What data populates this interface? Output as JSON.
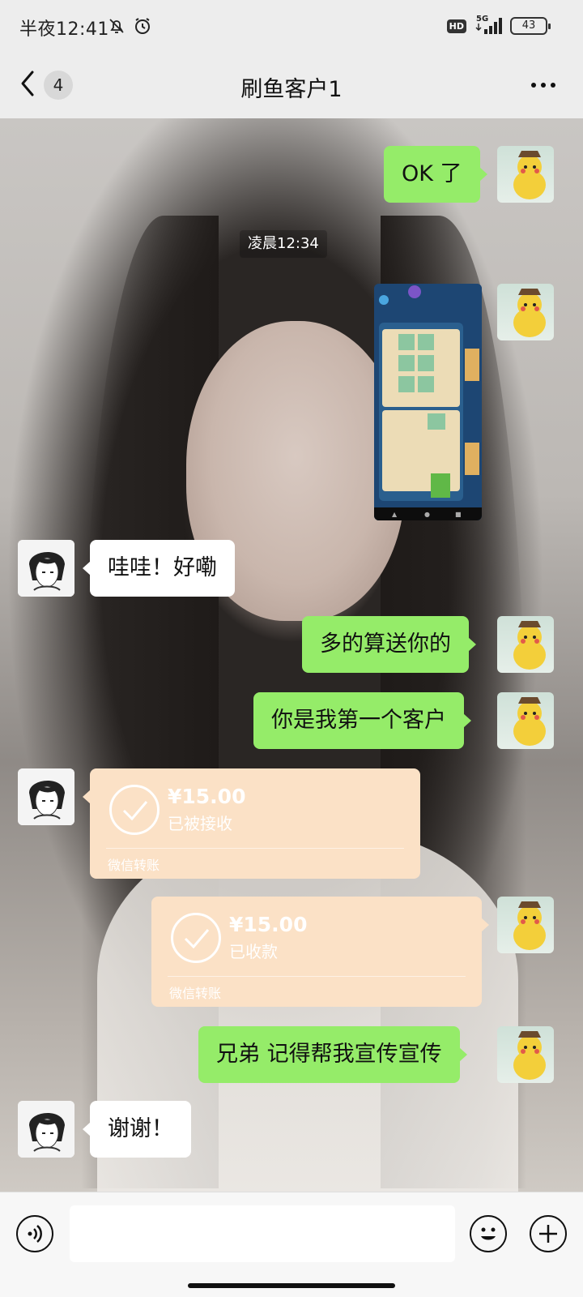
{
  "status_bar": {
    "time": "半夜12:41",
    "hd": "HD",
    "network": "5G",
    "battery": "43"
  },
  "header": {
    "back_count": "4",
    "title": "刷鱼客户1"
  },
  "messages": {
    "m1": "OK 了",
    "timestamp": "凌晨12:34",
    "m3": "哇哇！好嘞",
    "m4": "多的算送你的",
    "m5": "你是我第一个客户",
    "transfer_in": {
      "amount": "¥15.00",
      "status": "已被接收",
      "label": "微信转账"
    },
    "transfer_out": {
      "amount": "¥15.00",
      "status": "已收款",
      "label": "微信转账"
    },
    "m8": "兄弟 记得帮我宣传宣传",
    "m9": "谢谢！"
  },
  "input": {
    "placeholder": ""
  },
  "colors": {
    "me_bubble": "#95ec69",
    "other_bubble": "#ffffff",
    "transfer": "#fbe1c6",
    "background": "#ededed"
  },
  "icons": [
    "back-chevron-icon",
    "more-dots-icon",
    "voice-icon",
    "emoji-icon",
    "plus-icon",
    "mute-bell-icon",
    "alarm-icon",
    "signal-icon",
    "battery-icon"
  ]
}
